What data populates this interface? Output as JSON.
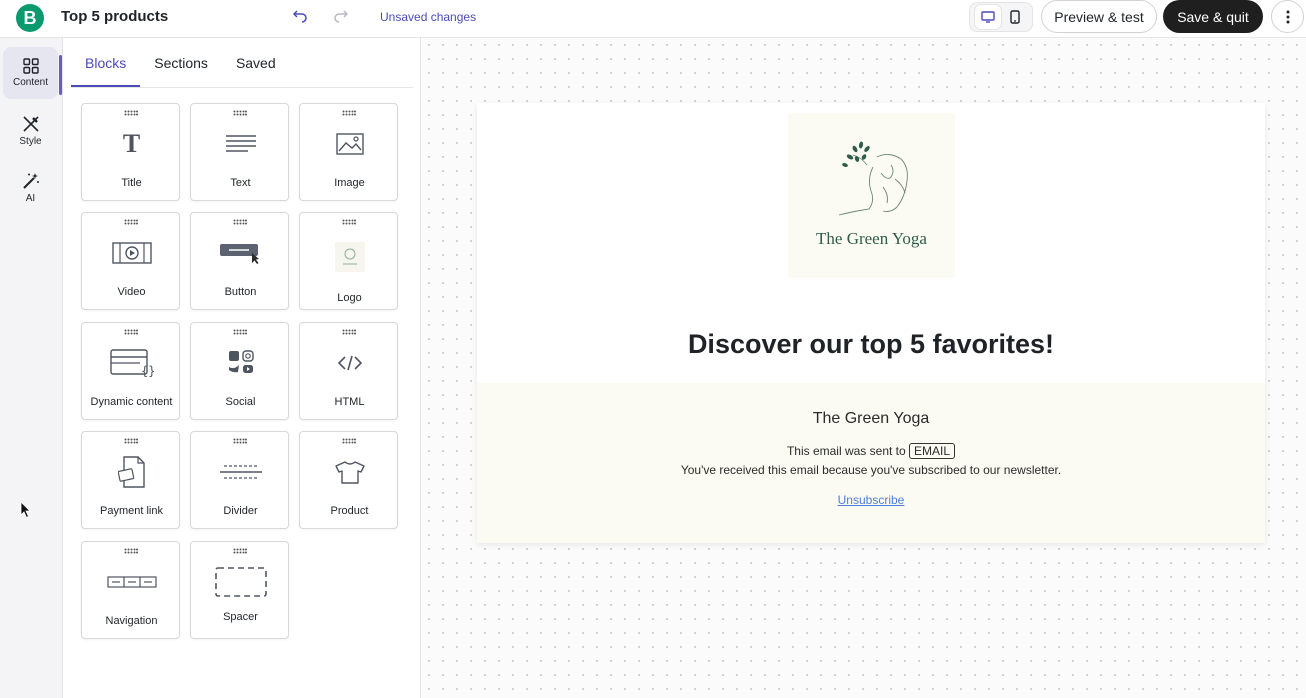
{
  "header": {
    "logo_letter": "B",
    "title": "Top 5 products",
    "status": "Unsaved changes",
    "preview_label": "Preview & test",
    "save_label": "Save & quit"
  },
  "rail": {
    "items": [
      {
        "label": "Content"
      },
      {
        "label": "Style"
      },
      {
        "label": "AI"
      }
    ]
  },
  "panel": {
    "tabs": [
      {
        "label": "Blocks"
      },
      {
        "label": "Sections"
      },
      {
        "label": "Saved"
      }
    ],
    "blocks": [
      {
        "label": "Title",
        "icon": "title-icon"
      },
      {
        "label": "Text",
        "icon": "text-icon"
      },
      {
        "label": "Image",
        "icon": "image-icon"
      },
      {
        "label": "Video",
        "icon": "video-icon"
      },
      {
        "label": "Button",
        "icon": "button-icon"
      },
      {
        "label": "Logo",
        "icon": "logo-icon"
      },
      {
        "label": "Dynamic content",
        "icon": "dynamic-content-icon"
      },
      {
        "label": "Social",
        "icon": "social-icon"
      },
      {
        "label": "HTML",
        "icon": "code-icon"
      },
      {
        "label": "Payment link",
        "icon": "payment-link-icon"
      },
      {
        "label": "Divider",
        "icon": "divider-icon"
      },
      {
        "label": "Product",
        "icon": "tshirt-icon"
      },
      {
        "label": "Navigation",
        "icon": "navigation-icon"
      },
      {
        "label": "Spacer",
        "icon": "spacer-icon"
      }
    ]
  },
  "email": {
    "logo_brand": "The Green Yoga",
    "headline": "Discover our top 5 favorites!",
    "footer_brand": "The Green Yoga",
    "sent_prefix": "This email was sent to",
    "email_tag": "EMAIL",
    "reason": "You've received this email because you've subscribed to our newsletter.",
    "unsubscribe": "Unsubscribe"
  },
  "colors": {
    "brand": "#0b996e",
    "accent": "#4b4bb8",
    "primary_button": "#1f1f1f"
  }
}
